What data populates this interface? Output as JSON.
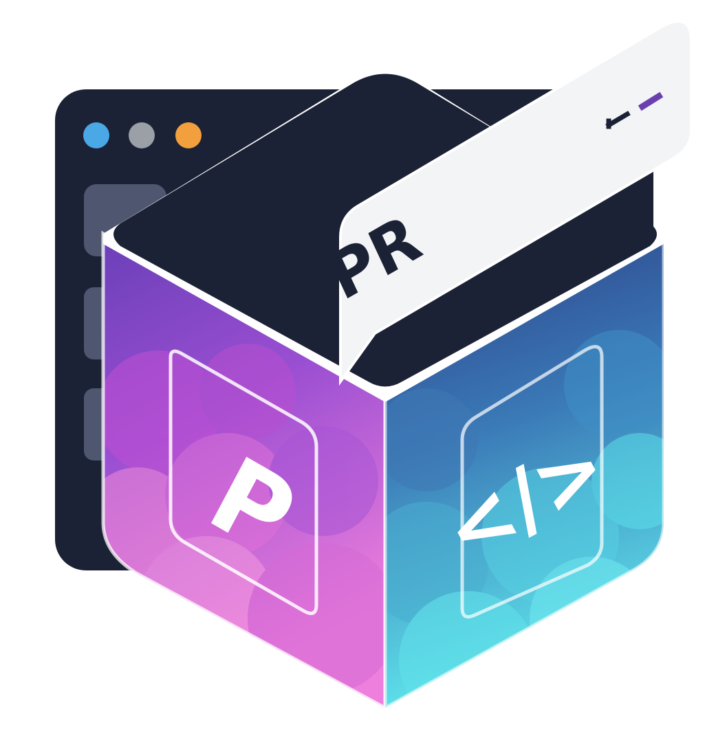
{
  "logo": {
    "bubble_text": "PR",
    "left_face_glyph": "P",
    "right_face_glyph": "</>",
    "bubble_mark": "- -"
  },
  "window": {
    "dots": [
      {
        "name": "blue-dot",
        "color": "#4aa8e6"
      },
      {
        "name": "gray-dot",
        "color": "#9aa0a6"
      },
      {
        "name": "orange-dot",
        "color": "#f2a03d"
      }
    ]
  },
  "colors": {
    "dark": "#1c2235",
    "bubble": "#f3f4f6",
    "accent_purple": "#6b3fb0",
    "magenta": "#e06ad6",
    "violet": "#6a3fb8",
    "navy": "#2b3f86",
    "cyan": "#55e0e8"
  }
}
